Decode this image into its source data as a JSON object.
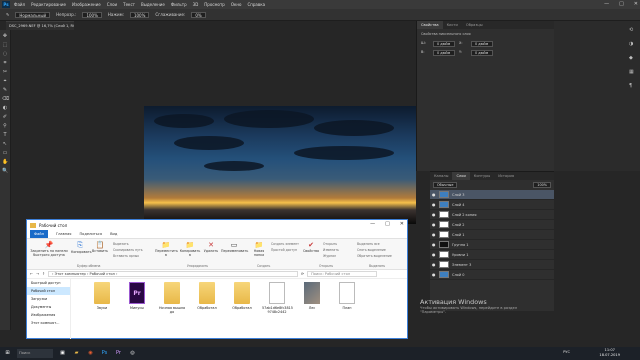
{
  "photoshop": {
    "logo": "Ps",
    "menu": [
      "Файл",
      "Редактирование",
      "Изображение",
      "Слои",
      "Текст",
      "Выделение",
      "Фильтр",
      "3D",
      "Просмотр",
      "Окно",
      "Справка"
    ],
    "window_controls": [
      "—",
      "□",
      "✕"
    ],
    "options": {
      "mode": "Нормальный",
      "opacity_label": "Непрозр.:",
      "opacity": "100%",
      "pressure": "Нажим:",
      "flow": "100%",
      "smooth_label": "Сглаживание:",
      "smooth": "0%"
    },
    "doc_tab": "DSC_2969.NEF @ 16,7% (Слой 1, RGB/8)",
    "tools": [
      "✥",
      "⬚",
      "◌",
      "⌗",
      "✂",
      "⌖",
      "✎",
      "⌫",
      "◐",
      "✐",
      "⚲",
      "T",
      "↖",
      "▭",
      "✋",
      "🔍"
    ],
    "properties": {
      "tabs": [
        "Свойства",
        "Кисти",
        "Образцы"
      ],
      "subtitle": "Свойства пиксельного слоя",
      "fields": [
        "Ш:",
        "В:",
        "X:",
        "Y:"
      ],
      "values": [
        "0 дюйм",
        "0 дюйм",
        "0 дюйм",
        "0 дюйм"
      ]
    },
    "layers": {
      "tabs": [
        "Каналы",
        "Слои",
        "Контуры",
        "История"
      ],
      "blend": "Обычные",
      "opacity": "100%",
      "items": [
        "Слой 3",
        "Слой 4",
        "Слой 2 копия",
        "Слой 2",
        "Слой 1",
        "Группа 1",
        "Уровни 1",
        "Элемент 3",
        "Слой 0"
      ]
    },
    "activation": {
      "title": "Активация Windows",
      "line1": "Чтобы активировать Windows, перейдите в раздел",
      "line2": "\"Параметры\"."
    }
  },
  "explorer": {
    "title": "Рабочий стол",
    "menu": [
      "Файл",
      "Главная",
      "Поделиться",
      "Вид"
    ],
    "ribbon": {
      "pin": "Закрепить на панели быстрого доступа",
      "copy": "Копировать",
      "paste": "Вставить",
      "cut": "Вырезать",
      "copy_path": "Скопировать путь",
      "paste_shortcut": "Вставить ярлык",
      "move": "Переместить в",
      "copy_to": "Копировать в",
      "delete": "Удалить",
      "rename": "Переименовать",
      "new_folder": "Новая папка",
      "new_item": "Создать элемент",
      "easy_access": "Простой доступ",
      "properties": "Свойства",
      "open": "Открыть",
      "edit": "Изменить",
      "history": "Журнал",
      "select_all": "Выделить все",
      "select_none": "Снять выделение",
      "invert": "Обратить выделение",
      "groups": [
        "Буфер обмена",
        "Упорядочить",
        "Создать",
        "Открыть",
        "Выделить"
      ]
    },
    "address": {
      "path": "› Этот компьютер › Рабочий стол ›",
      "search": "Поиск: Рабочий стол"
    },
    "nav": [
      "Быстрый доступ",
      "Рабочий стол",
      "Загрузки",
      "Документы",
      "Изображения",
      "Этот компьют..."
    ],
    "files": [
      "Звуки",
      "Минусы",
      "Ночная вышла до",
      "Обработал",
      "Обработал",
      "57ab1d6e8fc3815 9748c2442",
      "Лес",
      "План"
    ]
  },
  "taskbar": {
    "search": "Поиск",
    "lang": "РУС",
    "time": "11:07",
    "date": "18.07.2019"
  }
}
